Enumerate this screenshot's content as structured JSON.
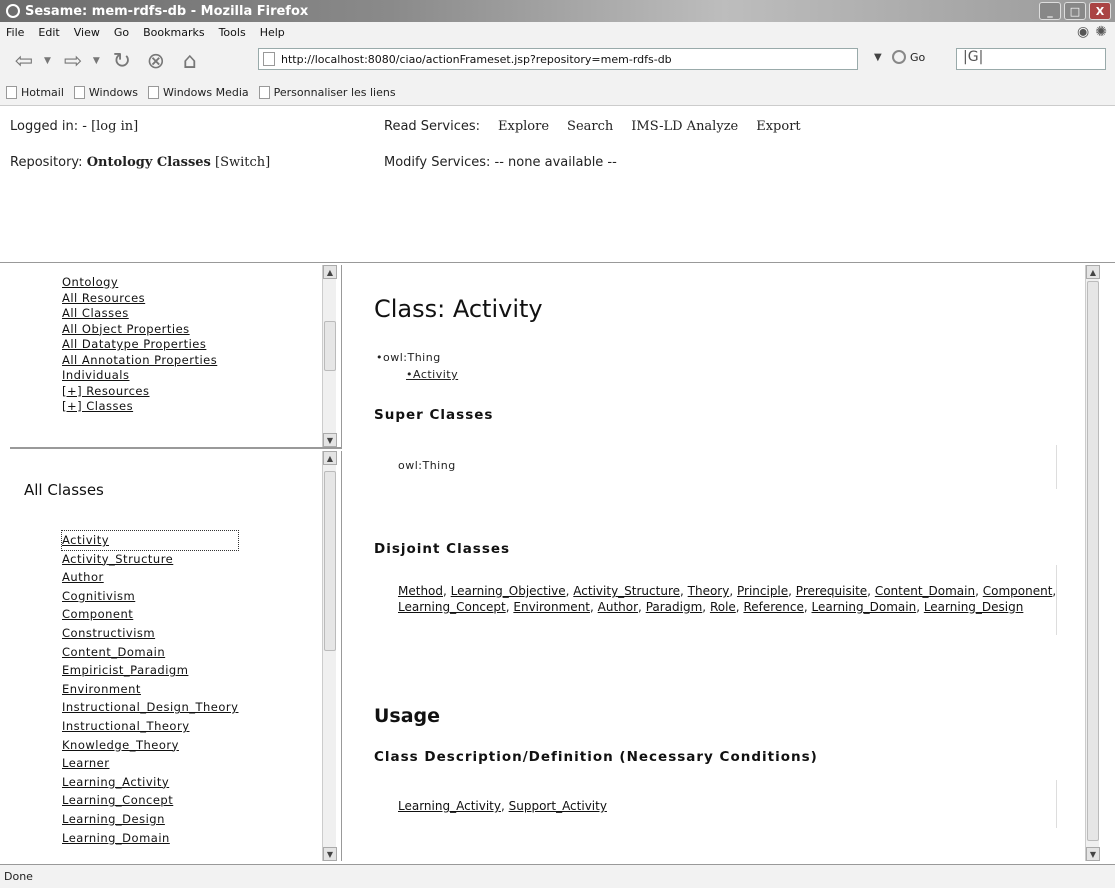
{
  "window": {
    "title": "Sesame: mem-rdfs-db - Mozilla Firefox",
    "controls": [
      "_",
      "□",
      "X"
    ]
  },
  "menu": [
    "File",
    "Edit",
    "View",
    "Go",
    "Bookmarks",
    "Tools",
    "Help"
  ],
  "nav": {
    "url": "http://localhost:8080/ciao/actionFrameset.jsp?repository=mem-rdfs-db",
    "go_label": "Go",
    "search_value": "|G|"
  },
  "bookmarks": [
    "Hotmail",
    "Windows",
    "Windows Media",
    "Personnaliser les liens"
  ],
  "header": {
    "logged_in_label": "Logged in: -",
    "login_link": "[log in]",
    "repository_label": "Repository:",
    "repository_name": "Ontology Classes",
    "switch_link": "[Switch]",
    "read_services_label": "Read Services:",
    "read_services": [
      "Explore",
      "Search",
      "IMS-LD Analyze",
      "Export"
    ],
    "modify_services_label": "Modify Services:",
    "modify_services_value": "-- none available --"
  },
  "nav_frame": {
    "links": [
      "Ontology",
      "All Resources",
      "All Classes",
      "All Object Properties",
      "All Datatype Properties",
      "All Annotation Properties",
      "Individuals",
      "[+] Resources",
      "[+] Classes"
    ]
  },
  "classes_frame": {
    "heading": "All Classes",
    "items": [
      "Activity",
      "Activity_Structure",
      "Author",
      "Cognitivism",
      "Component",
      "Constructivism",
      "Content_Domain",
      "Empiricist_Paradigm",
      "Environment",
      "Instructional_Design_Theory",
      "Instructional_Theory",
      "Knowledge_Theory",
      "Learner",
      "Learning_Activity",
      "Learning_Concept",
      "Learning_Design",
      "Learning_Domain"
    ]
  },
  "main": {
    "class_title": "Class: Activity",
    "tree_root": "•owl:Thing",
    "tree_child": "•Activity",
    "super_heading": "Super Classes",
    "super_value": "owl:Thing",
    "disjoint_heading": "Disjoint Classes",
    "disjoint": [
      "Method",
      "Learning_Objective",
      "Activity_Structure",
      "Theory",
      "Principle",
      "Prerequisite",
      "Content_Domain",
      "Component",
      "Learning_Concept",
      "Environment",
      "Author",
      "Paradigm",
      "Role",
      "Reference",
      "Learning_Domain",
      "Learning_Design"
    ],
    "usage_heading": "Usage",
    "necessary_heading": "Class Description/Definition (Necessary Conditions)",
    "necessary": [
      "Learning_Activity",
      "Support_Activity"
    ]
  },
  "status": "Done"
}
